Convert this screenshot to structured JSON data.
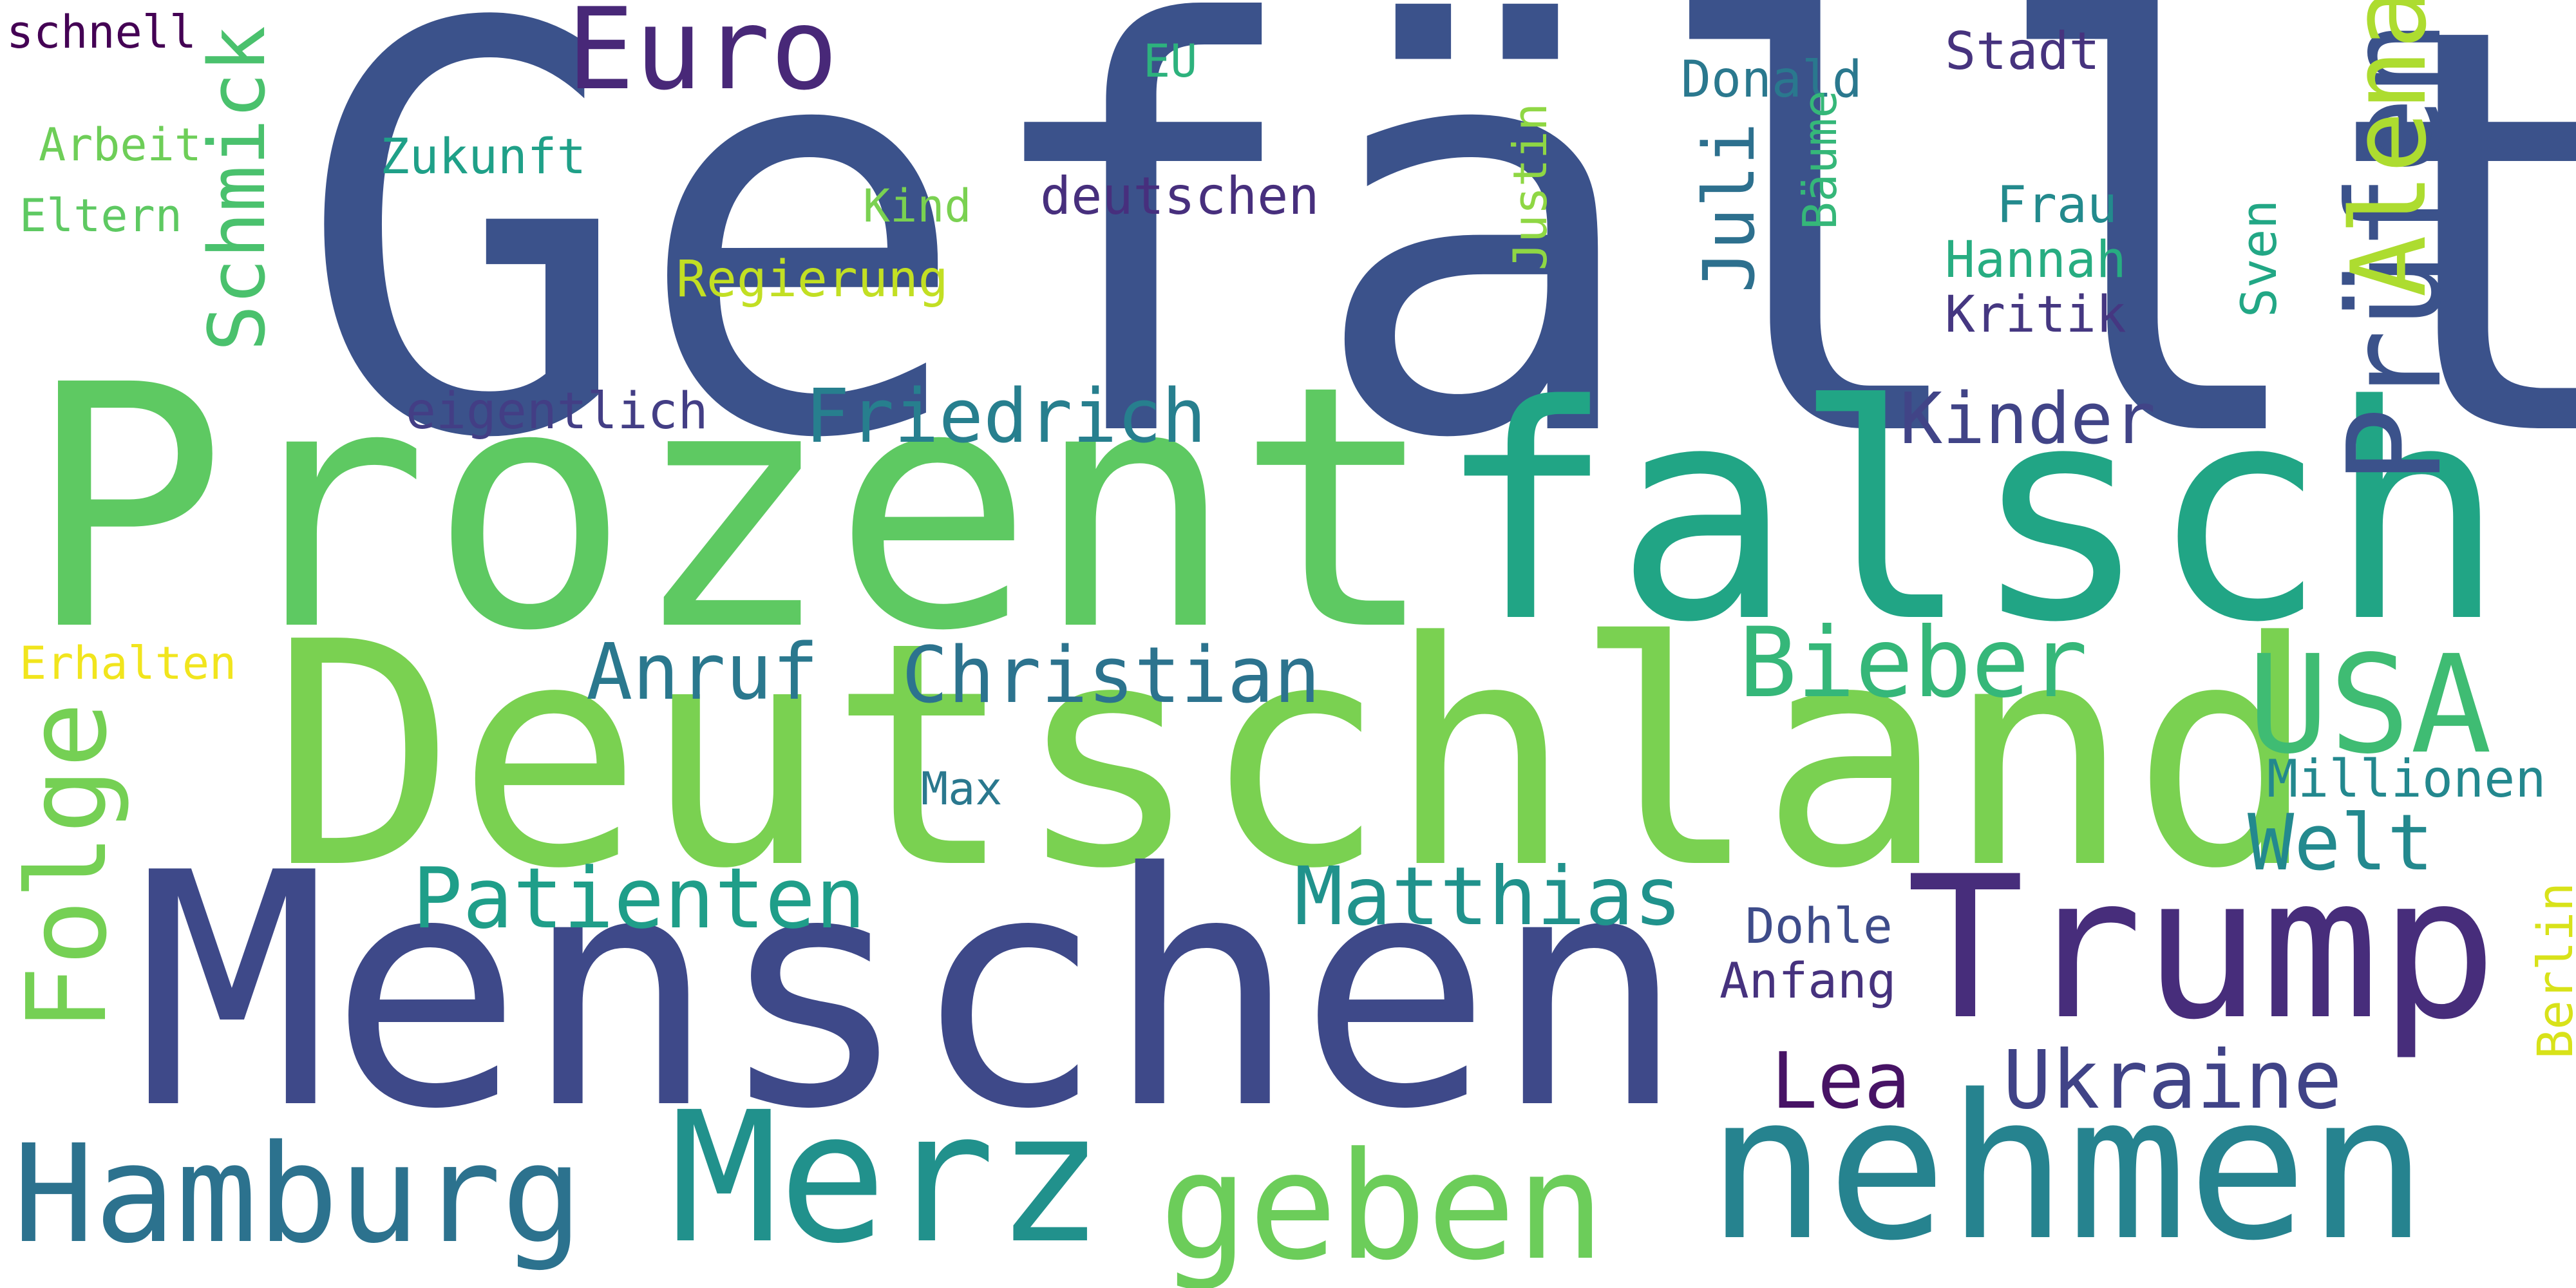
{
  "wordcloud": {
    "words": [
      {
        "text": "Gefällt",
        "color": "#3b528b"
      },
      {
        "text": "Prozent",
        "color": "#5ec962"
      },
      {
        "text": "falsch",
        "color": "#21a585"
      },
      {
        "text": "Deutschland",
        "color": "#7ad151"
      },
      {
        "text": "Menschen",
        "color": "#3e4989"
      },
      {
        "text": "Trump",
        "color": "#472d7b"
      },
      {
        "text": "nehmen",
        "color": "#26838f"
      },
      {
        "text": "Merz",
        "color": "#21918c"
      },
      {
        "text": "geben",
        "color": "#6ccd5a"
      },
      {
        "text": "Hamburg",
        "color": "#2c728e"
      },
      {
        "text": "USA",
        "color": "#3fbc73"
      },
      {
        "text": "Prüfen",
        "color": "#3b528b"
      },
      {
        "text": "Alena",
        "color": "#addc30"
      },
      {
        "text": "Folge",
        "color": "#75d054"
      },
      {
        "text": "Euro",
        "color": "#482878"
      },
      {
        "text": "Bieber",
        "color": "#35b779"
      },
      {
        "text": "Patienten",
        "color": "#1f9e89"
      },
      {
        "text": "Matthias",
        "color": "#20928c"
      },
      {
        "text": "Ukraine",
        "color": "#404387"
      },
      {
        "text": "Welt",
        "color": "#23898e"
      },
      {
        "text": "Lea",
        "color": "#471365"
      },
      {
        "text": "Christian",
        "color": "#2c738e"
      },
      {
        "text": "Anruf",
        "color": "#2a788e"
      },
      {
        "text": "Schmick",
        "color": "#4ac16d"
      },
      {
        "text": "Friedrich",
        "color": "#277f8e"
      },
      {
        "text": "Kinder",
        "color": "#414487"
      },
      {
        "text": "Juli",
        "color": "#2d708e"
      },
      {
        "text": "Stadt",
        "color": "#46337e"
      },
      {
        "text": "Donald",
        "color": "#2a788e"
      },
      {
        "text": "Hannah",
        "color": "#27ad81"
      },
      {
        "text": "Millionen",
        "color": "#23888e"
      },
      {
        "text": "Frau",
        "color": "#238a8d"
      },
      {
        "text": "Kritik",
        "color": "#453781"
      },
      {
        "text": "Regierung",
        "color": "#c2df23"
      },
      {
        "text": "eigentlich",
        "color": "#433e85"
      },
      {
        "text": "deutschen",
        "color": "#472f7d"
      },
      {
        "text": "Dohle",
        "color": "#3e4c8a"
      },
      {
        "text": "Anfang",
        "color": "#46327e"
      },
      {
        "text": "Zukunft",
        "color": "#1fa088"
      },
      {
        "text": "Berlin",
        "color": "#d8e219"
      },
      {
        "text": "Sven",
        "color": "#22a785"
      },
      {
        "text": "Justin",
        "color": "#8fd744"
      },
      {
        "text": "Bäume",
        "color": "#35b779"
      },
      {
        "text": "Arbeit",
        "color": "#6ece58"
      },
      {
        "text": "Eltern",
        "color": "#5ec962"
      },
      {
        "text": "Kind",
        "color": "#7ad151"
      },
      {
        "text": "Erhalten",
        "color": "#f1e51d"
      },
      {
        "text": "schnell",
        "color": "#440154"
      },
      {
        "text": "Max",
        "color": "#2a788e"
      },
      {
        "text": "EU",
        "color": "#2db27d"
      }
    ]
  }
}
